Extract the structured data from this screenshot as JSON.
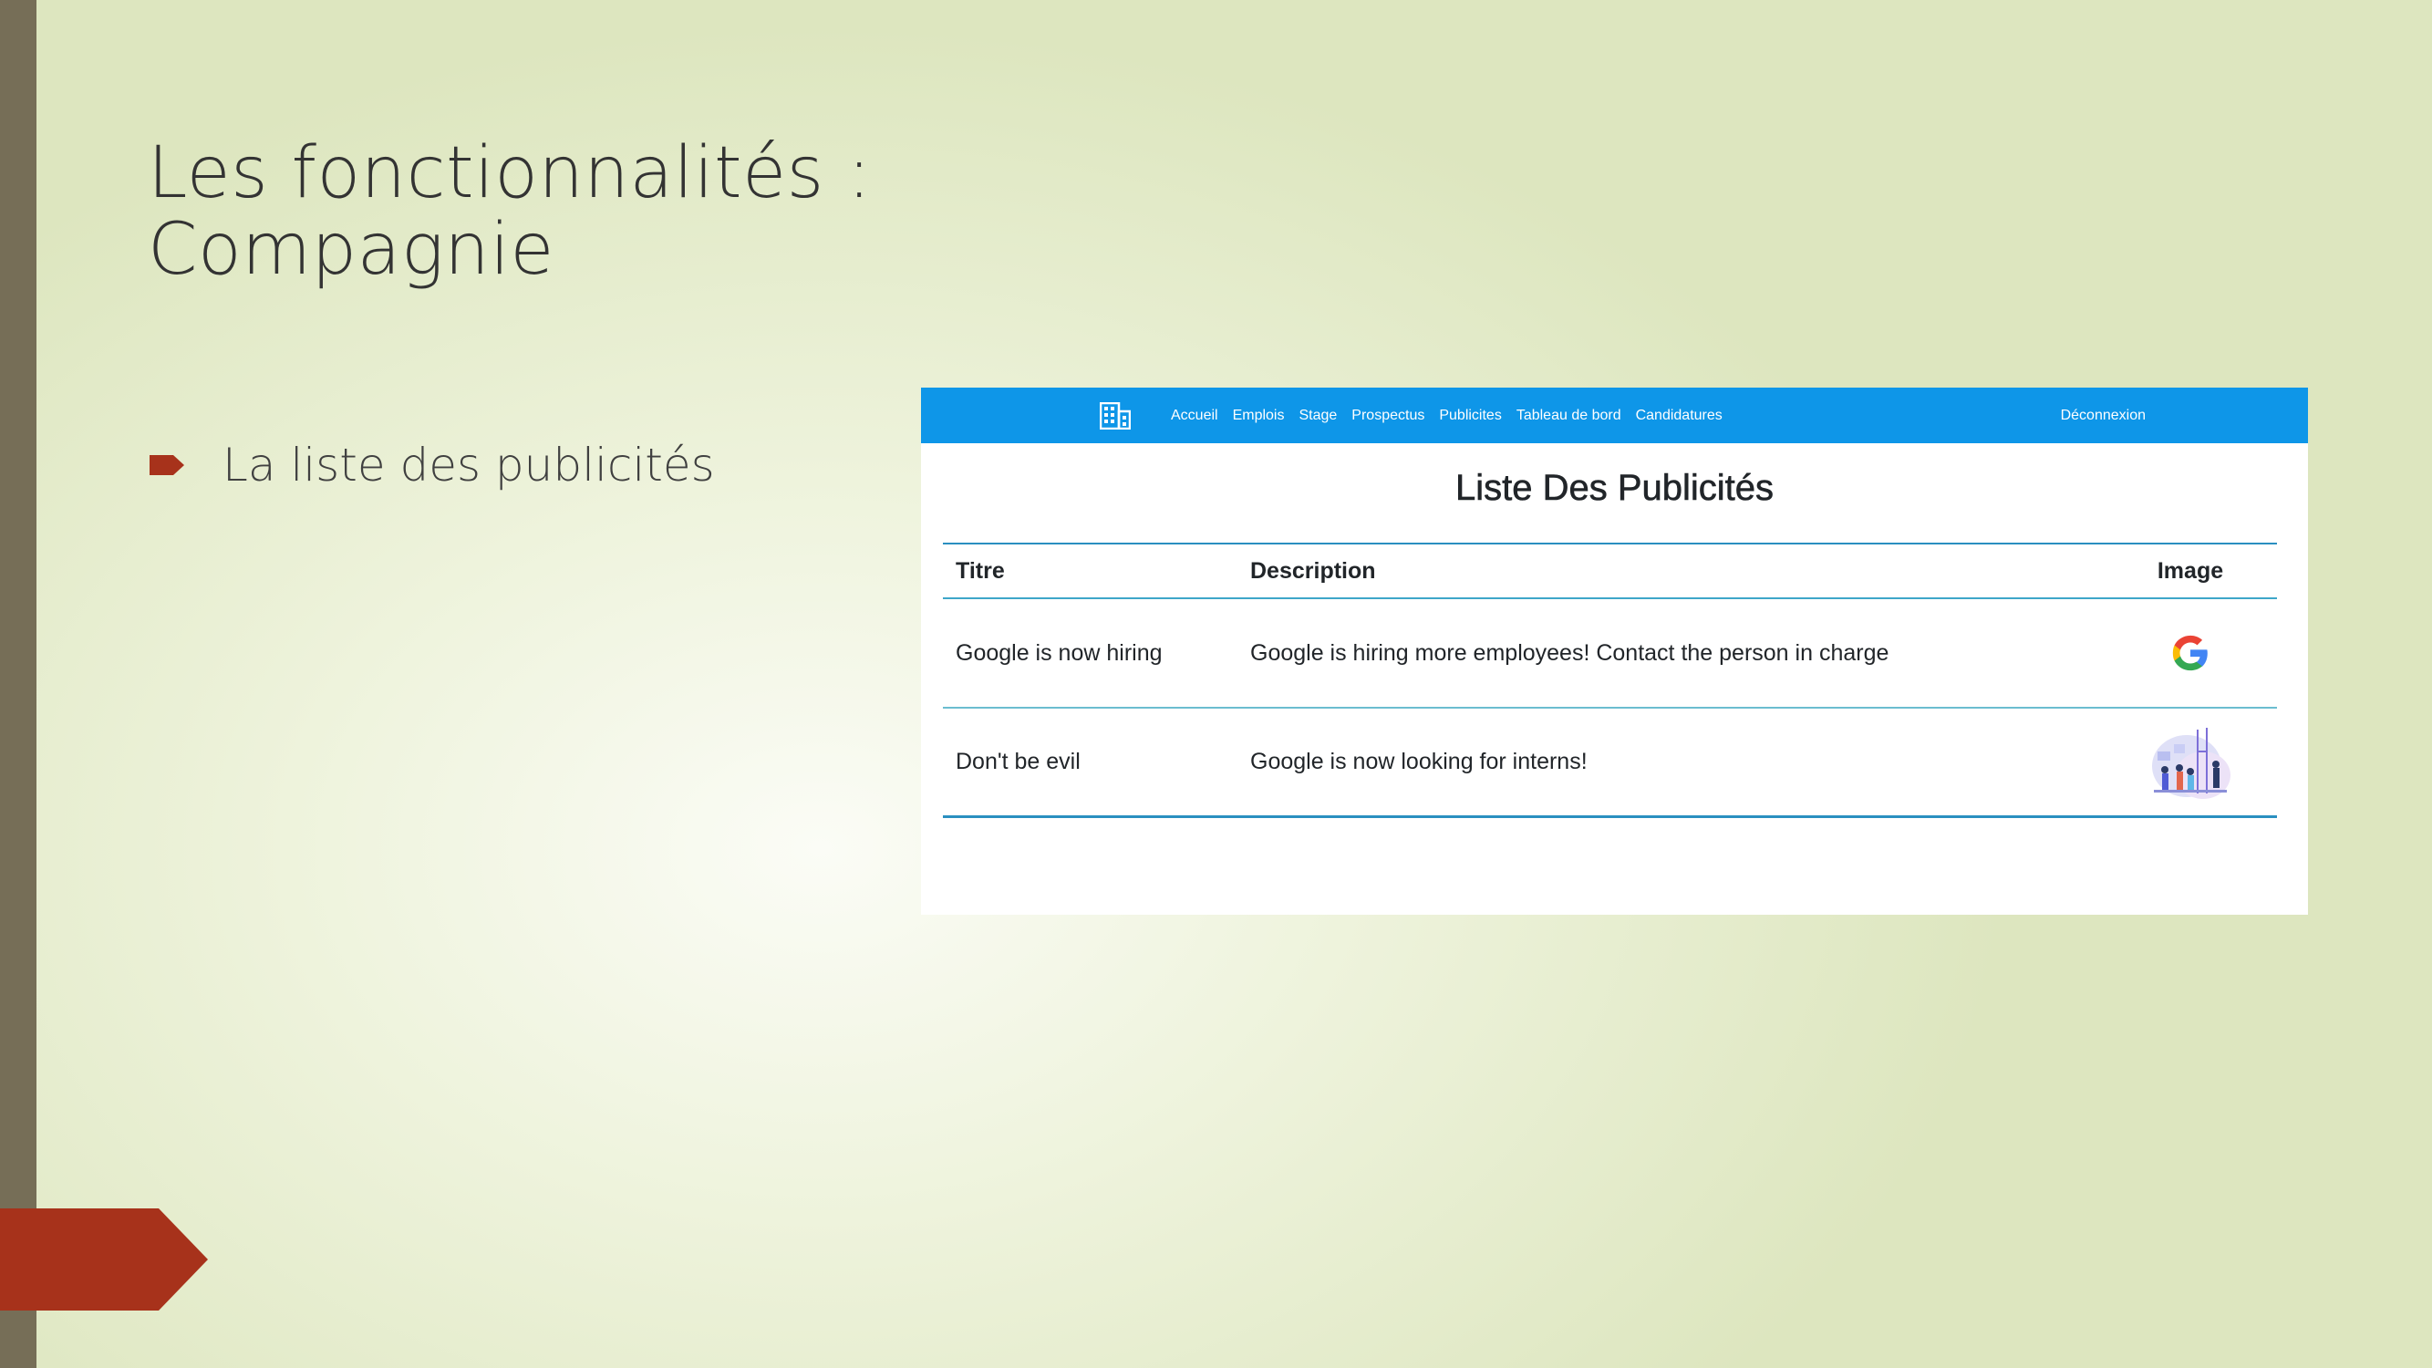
{
  "slide": {
    "title_line1": "Les fonctionnalités :",
    "title_line2": "Compagnie",
    "bullet": "La liste des publicités"
  },
  "screenshot": {
    "navbar": {
      "brand_icon": "building-icon",
      "links": [
        "Accueil",
        "Emplois",
        "Stage",
        "Prospectus",
        "Publicites",
        "Tableau de bord",
        "Candidatures"
      ],
      "logout": "Déconnexion",
      "color": "#0e96e8"
    },
    "heading": "Liste Des Publicités",
    "table": {
      "headers": [
        "Titre",
        "Description",
        "Image"
      ],
      "rows": [
        {
          "title": "Google is now hiring",
          "description": "Google is hiring more employees! Contact the person in charge",
          "image": "google-logo-icon"
        },
        {
          "title": "Don't be evil",
          "description": "Google is now looking for interns!",
          "image": "people-illustration-icon"
        }
      ]
    }
  },
  "colors": {
    "accent": "#a7321b",
    "side_bar": "#766e57"
  }
}
